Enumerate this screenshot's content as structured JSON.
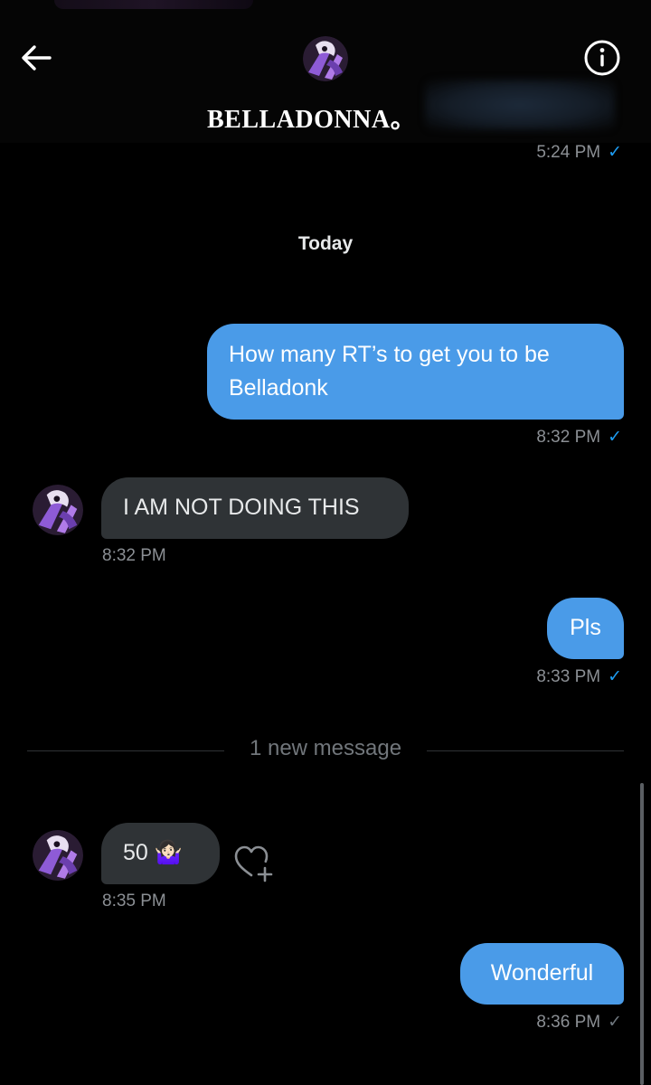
{
  "header": {
    "back_icon": "arrow-left-icon",
    "info_icon": "info-circle-icon",
    "contact_name": "BELLADONNA。"
  },
  "earlier": {
    "last_timestamp": "5:24 PM"
  },
  "day_separator": "Today",
  "messages": [
    {
      "direction": "out",
      "text": "How many RT’s to get you to be Belladonk",
      "time": "8:32 PM",
      "read": true
    },
    {
      "direction": "in",
      "text": "I AM NOT DOING THIS",
      "time": "8:32 PM"
    },
    {
      "direction": "out",
      "text": "Pls",
      "time": "8:33 PM",
      "read": true
    },
    {
      "direction": "in",
      "text": "50 🤷🏻‍♀️",
      "time": "8:35 PM"
    },
    {
      "direction": "out",
      "text": "Wonderful",
      "time": "8:36 PM",
      "read": false
    }
  ],
  "new_message_divider": "1 new message",
  "colors": {
    "background": "#000000",
    "outgoing_bubble": "#4a9be8",
    "incoming_bubble": "#2f3336",
    "accent_check": "#1d9bf0",
    "timestamp": "#8b8f94",
    "avatar_purple": "#9b59d0"
  },
  "reaction_icon": "heart-plus-icon",
  "check_glyph": "✓"
}
